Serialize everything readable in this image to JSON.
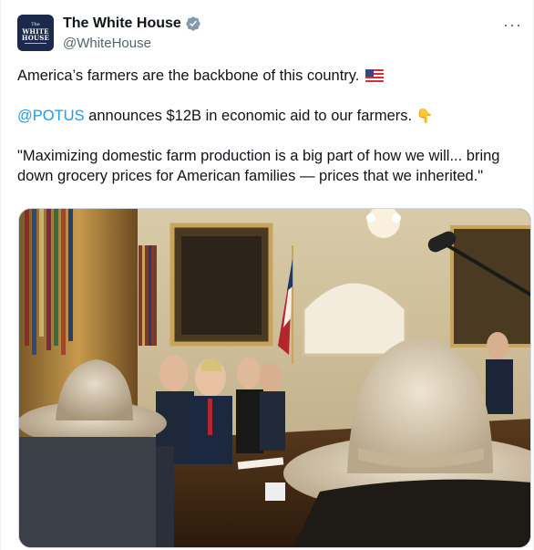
{
  "account": {
    "display_name": "The White House",
    "handle": "@WhiteHouse",
    "verified": true,
    "avatar_text": {
      "small": "The",
      "line1": "WHITE",
      "line2": "HOUSE"
    }
  },
  "menu": {
    "more_icon": "more-horizontal-icon",
    "more_glyph": "···"
  },
  "tweet": {
    "line1": "America’s farmers are the backbone of this country.",
    "line1_emoji": "us-flag-emoji",
    "mention": "@POTUS",
    "line2_rest": " announces $12B in economic aid to our farmers.",
    "line2_emoji": "pointing-down-hand-emoji",
    "line2_emoji_glyph": "👇",
    "quote": "\"Maximizing domestic farm production is a big part of how we will... bring down grocery prices for American families — prices that we inherited.\""
  },
  "media": {
    "type": "photo",
    "subject": "white-house-meeting-photo"
  },
  "colors": {
    "link": "#1d9bf0",
    "text": "#0f1419",
    "secondary": "#536471",
    "verified_badge": "#829aab",
    "border": "#cfd9de"
  }
}
